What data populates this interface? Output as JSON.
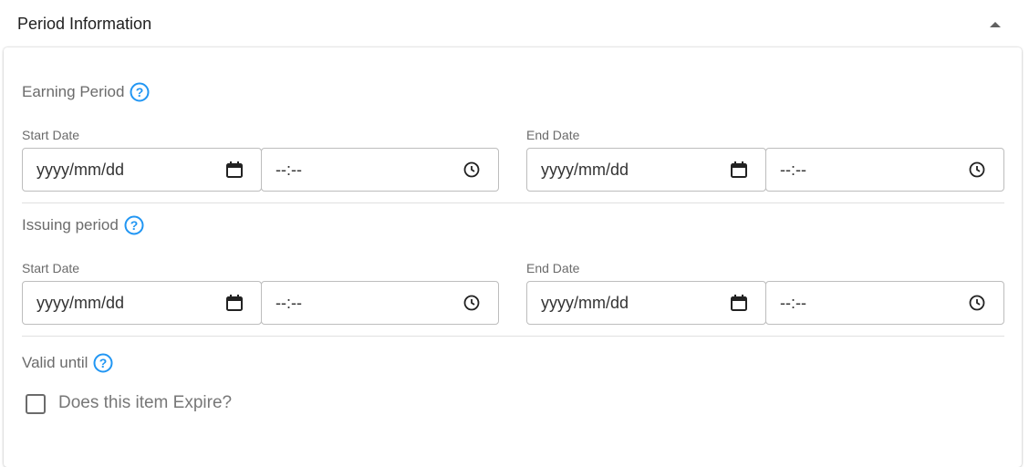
{
  "header": {
    "title": "Period Information",
    "collapse_icon": "caret-up-icon"
  },
  "colors": {
    "accent": "#2196f3",
    "border": "#bdbdbd",
    "label": "#6b6b6b"
  },
  "sections": [
    {
      "label": "Earning Period",
      "start": {
        "label": "Start Date",
        "date_placeholder": "yyyy/mm/dd",
        "time_placeholder": "--:--"
      },
      "end": {
        "label": "End Date",
        "date_placeholder": "yyyy/mm/dd",
        "time_placeholder": "--:--"
      }
    },
    {
      "label": "Issuing period",
      "start": {
        "label": "Start Date",
        "date_placeholder": "yyyy/mm/dd",
        "time_placeholder": "--:--"
      },
      "end": {
        "label": "End Date",
        "date_placeholder": "yyyy/mm/dd",
        "time_placeholder": "--:--"
      }
    }
  ],
  "valid_until": {
    "label": "Valid until",
    "checkbox_label": "Does this item Expire?",
    "checked": false
  }
}
